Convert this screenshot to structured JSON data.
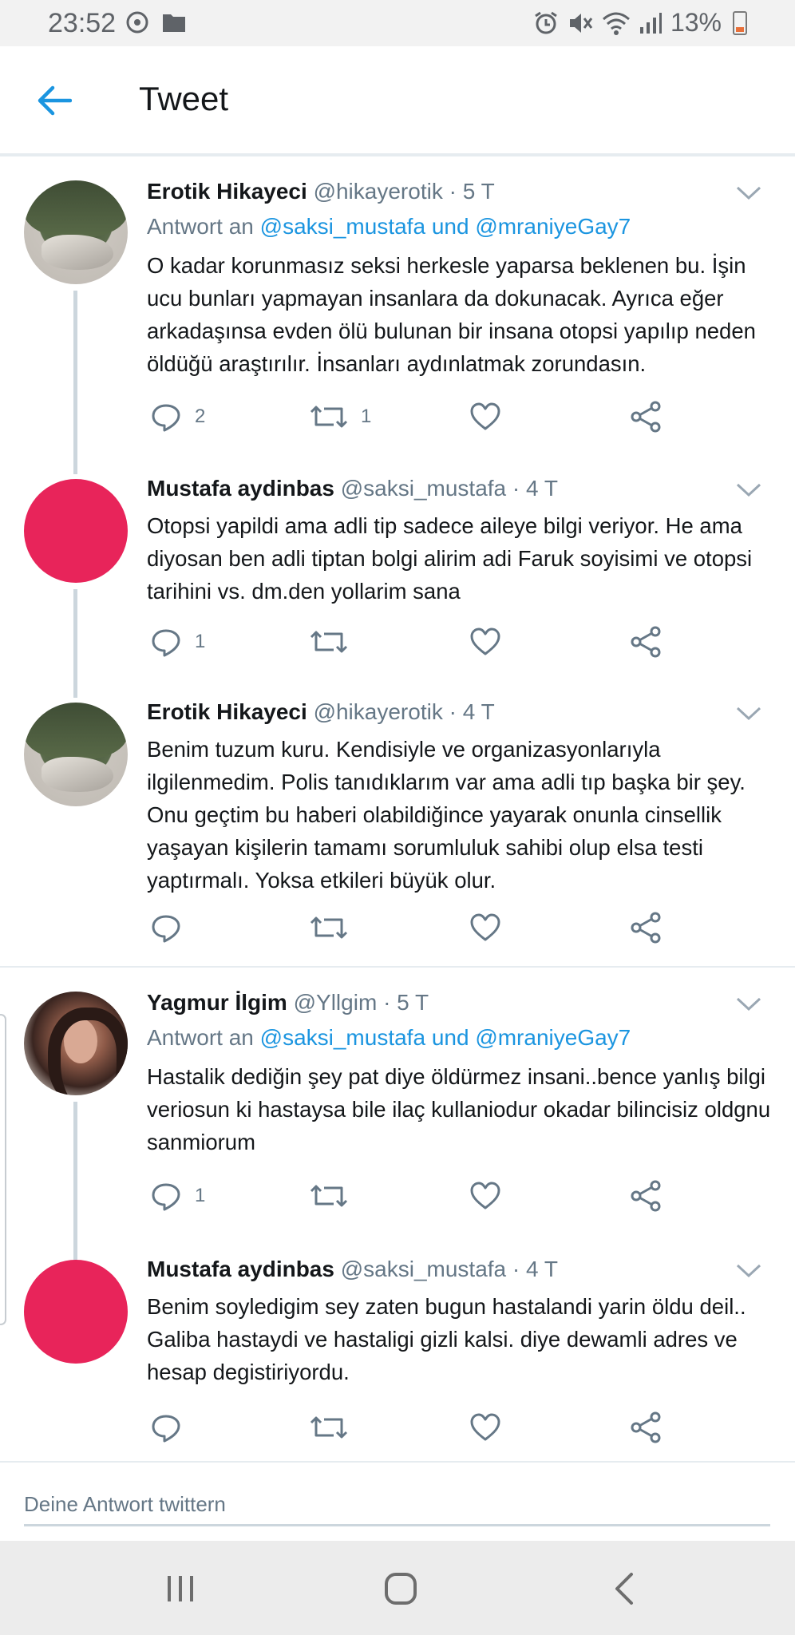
{
  "status_bar": {
    "time": "23:52",
    "battery": "13%",
    "icons": [
      "sync-icon",
      "folder-icon",
      "alarm-icon",
      "mute-icon",
      "wifi-icon",
      "signal-icon",
      "battery-icon"
    ]
  },
  "app_bar": {
    "title": "Tweet",
    "back_icon": "arrow-left-icon"
  },
  "colors": {
    "accent": "#1b95e0",
    "avatar_red": "#e8245a",
    "muted": "#657786",
    "thread_line": "#ccd6dd"
  },
  "tweets": [
    {
      "name": "Erotik Hikayeci",
      "handle": "@hikayerotik",
      "time": "5 T",
      "reply_prefix": "Antwort an",
      "reply_user1": "@saksi_mustafa",
      "reply_joiner": "und",
      "reply_user2": "@mraniyeGay7",
      "text": "O kadar korunmasız seksi herkesle yaparsa beklenen bu. İşin ucu bunları yapmayan insanlara da dokunacak. Ayrıca eğer arkadaşınsa evden ölü bulunan bir insana otopsi yapılıp neden öldüğü araştırılır. İnsanları aydınlatmak zorundasın.",
      "replies": "2",
      "retweets": "1"
    },
    {
      "name": "Mustafa aydinbas",
      "handle": "@saksi_mustafa",
      "time": "4 T",
      "text": "Otopsi yapildi ama adli tip sadece aileye bilgi veriyor. He ama diyosan ben adli tiptan bolgi alirim adi Faruk soyisimi ve otopsi tarihini vs. dm.den yollarim sana",
      "replies": "1",
      "retweets": ""
    },
    {
      "name": "Erotik Hikayeci",
      "handle": "@hikayerotik",
      "time": "4 T",
      "text": "Benim tuzum kuru. Kendisiyle ve organizasyonlarıyla ilgilenmedim. Polis tanıdıklarım var ama adli tıp başka bir şey. Onu geçtim bu haberi olabildiğince yayarak onunla cinsellik yaşayan kişilerin tamamı sorumluluk sahibi olup elsa testi yaptırmalı. Yoksa etkileri büyük olur.",
      "replies": "",
      "retweets": ""
    },
    {
      "name": "Yagmur İlgim",
      "handle": "@Yllgim",
      "time": "5 T",
      "reply_prefix": "Antwort an",
      "reply_user1": "@saksi_mustafa",
      "reply_joiner": "und",
      "reply_user2": "@mraniyeGay7",
      "text": "Hastalik dediğin şey pat diye öldürmez insani..bence yanlış bilgi veriosun ki hastaysa bile ilaç kullaniodur okadar bilincisiz oldgnu sanmiorum",
      "replies": "1",
      "retweets": ""
    },
    {
      "name": "Mustafa aydinbas",
      "handle": "@saksi_mustafa",
      "time": "4 T",
      "text": "Benim soyledigim sey zaten bugun hastalandi yarin öldu deil.. Galiba hastaydi ve hastaligi gizli kalsi. diye dewamli adres ve hesap degistiriyordu.",
      "replies": "",
      "retweets": ""
    }
  ],
  "reply_box": {
    "placeholder": "Deine Antwort twittern"
  },
  "nav": {
    "recents_icon": "recents-icon",
    "home_icon": "home-icon",
    "back_icon": "back-icon"
  }
}
